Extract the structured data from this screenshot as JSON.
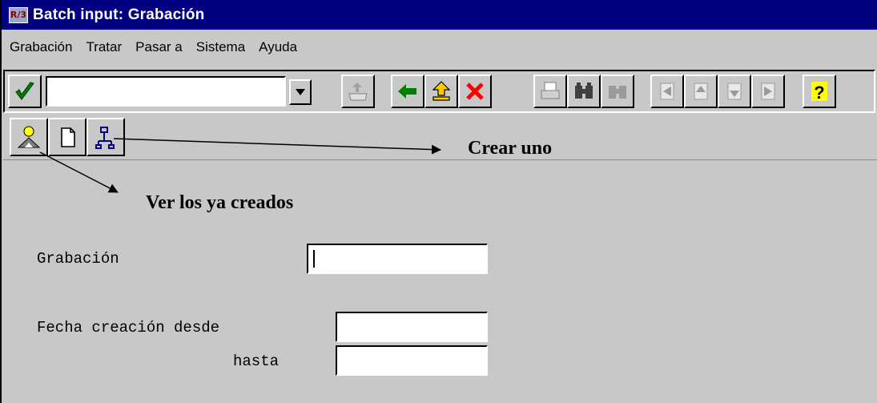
{
  "window": {
    "title": "Batch input: Grabación",
    "icon_label": "R/3"
  },
  "menu": [
    {
      "label": "Grabación"
    },
    {
      "label": "Tratar"
    },
    {
      "label": "Pasar a"
    },
    {
      "label": "Sistema"
    },
    {
      "label": "Ayuda"
    }
  ],
  "toolbar": {
    "command_value": "",
    "icons": [
      "check-icon",
      "dropdown-arrow-icon",
      "save-icon",
      "back-icon",
      "exit-icon",
      "cancel-icon",
      "print-icon",
      "find-icon",
      "find-next-icon",
      "first-page-icon",
      "previous-page-icon",
      "next-page-icon",
      "last-page-icon",
      "help-icon"
    ]
  },
  "app_toolbar": {
    "icons": [
      "overview-icon",
      "create-icon",
      "hierarchy-icon"
    ]
  },
  "form": {
    "grabacion_label": "Grabación",
    "grabacion_value": "",
    "fecha_desde_label": "Fecha creación desde",
    "fecha_desde_value": "",
    "hasta_label": "hasta",
    "hasta_value": ""
  },
  "annotations": {
    "create_one": "Crear uno",
    "view_created": "Ver los ya creados"
  },
  "colors": {
    "titlebar": "#000080",
    "background": "#c8c8c8",
    "check_green": "#008000",
    "back_green": "#008000",
    "cancel_red": "#ff0000",
    "help_yellow": "#ffff00"
  }
}
